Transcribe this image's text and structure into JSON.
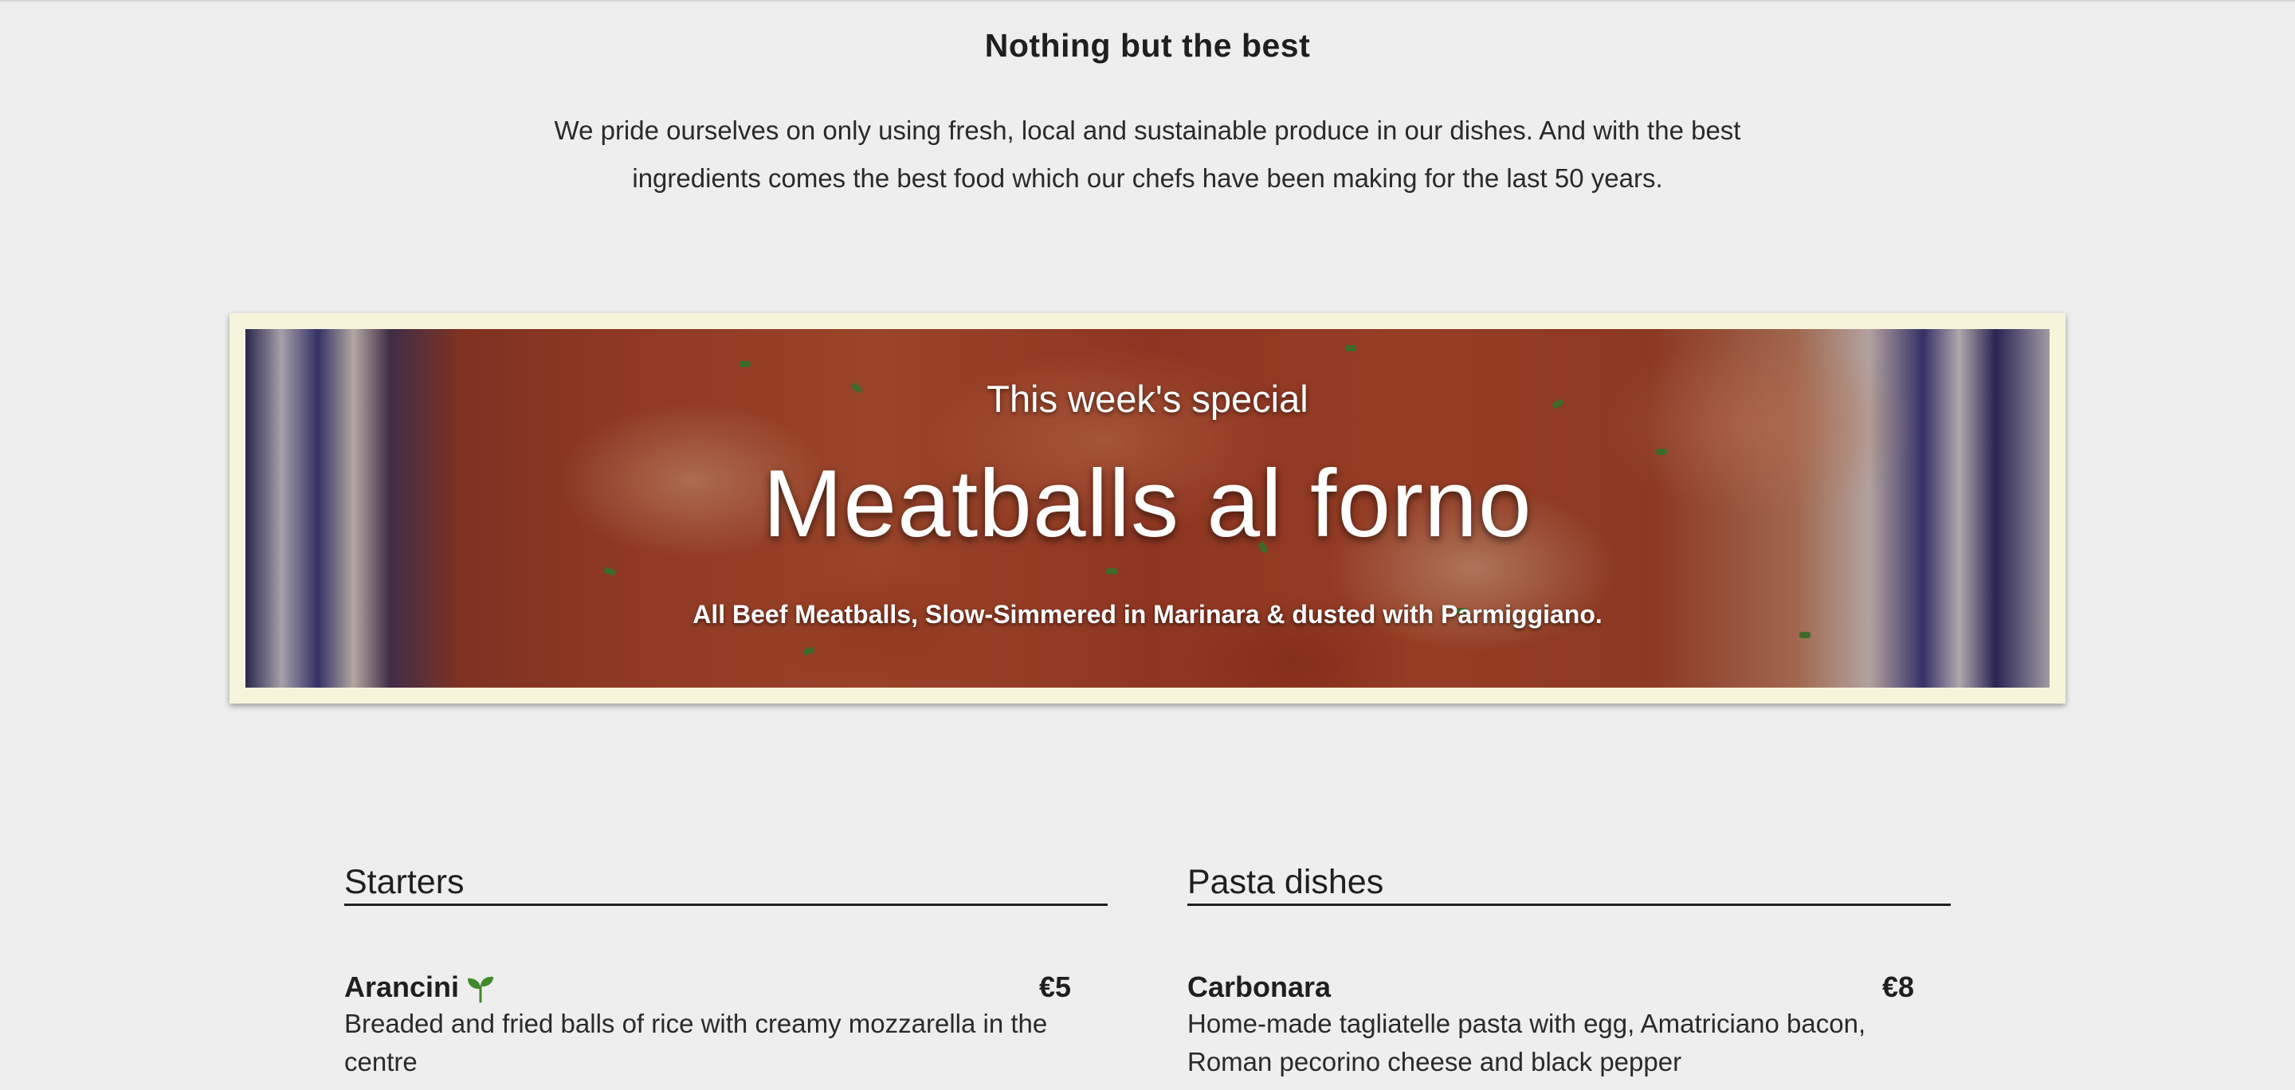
{
  "intro": {
    "title": "Nothing but the best",
    "text": "We pride ourselves on only using fresh, local and sustainable produce in our dishes. And with the best ingredients comes the best food which our chefs have been making for the last 50 years."
  },
  "special": {
    "kicker": "This week's special",
    "title": "Meatballs al forno",
    "description": "All Beef Meatballs, Slow-Simmered in Marinara & dusted with Parmiggiano."
  },
  "menu": {
    "starters": {
      "heading": "Starters",
      "items": [
        {
          "name": "Arancini",
          "icon": "sprout-icon",
          "price": "€5",
          "description": "Breaded and fried balls of rice with creamy mozzarella in the centre"
        }
      ]
    },
    "pasta": {
      "heading": "Pasta dishes",
      "items": [
        {
          "name": "Carbonara",
          "price": "€8",
          "description": "Home-made tagliatelle pasta with egg, Amatriciano bacon, Roman pecorino cheese and black pepper"
        }
      ]
    }
  },
  "colors": {
    "background": "#eeeeee",
    "frame": "#f6f5dc",
    "veg_icon": "#3f8a2a"
  }
}
